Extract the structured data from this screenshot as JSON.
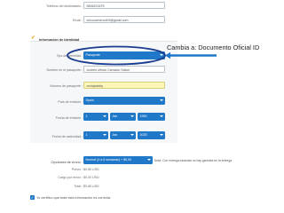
{
  "form": {
    "phone_label": "Teléfono del destinatario :",
    "phone_value": "5806221675",
    "email_label": "Email :",
    "email_value": "chicocamercol09@gmail.com",
    "section_title": "Información de Identidad",
    "doc_type_label": "Tipo de identidad :",
    "doc_type_value": "Pasaporte",
    "name_label": "Nombre en el pasaporte :",
    "name_value": "Andrés Ulindo Camacio Salios",
    "passport_label": "Número de pasaporte :",
    "passport_value": "xxxtqbabbp",
    "country_label": "País de emisión :",
    "country_value": "Spain",
    "issue_label": "Fecha de emisión :",
    "issue_day": "1",
    "issue_month": "Jan",
    "issue_year": "1990",
    "expiry_label": "Fecha de caducidad :",
    "expiry_day": "1",
    "expiry_month": "Jan",
    "expiry_year": "2025"
  },
  "annotation": {
    "text": "Cambia a: Documento Oficial ID"
  },
  "shipping": {
    "options_label": "Opciones de envío :",
    "option_value": "Normal (4 a 6 semanas) + $0.00",
    "note": "Nota: Con entrega estándar no hay garantía en la entrega",
    "price_label": "Precio :",
    "price_value": "$0.85 USD",
    "cost_label": "Cargo por envío :",
    "cost_value": "$0.00 USD",
    "total_label": "Total :",
    "total_value": "$0.85 USD",
    "certify_text": "Yo certifico que toda esta información es correcta."
  },
  "colors": {
    "select_blue": "#1f78c8",
    "highlight_circle": "#1a3d8f",
    "passport_field_bg": "#fdf6b6",
    "section_icon": "#e8a21e"
  }
}
